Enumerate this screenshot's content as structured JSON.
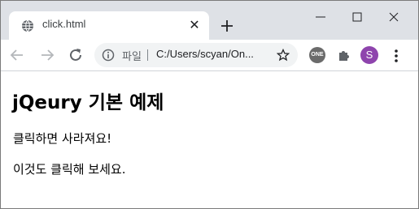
{
  "tab": {
    "title": "click.html",
    "close_glyph": "✕",
    "favicon": "globe-icon"
  },
  "new_tab": {
    "icon": "plus-icon"
  },
  "window_controls": {
    "minimize": "minimize-icon",
    "maximize": "maximize-icon",
    "close": "close-icon"
  },
  "toolbar": {
    "back": "back-arrow-icon",
    "forward": "forward-arrow-icon",
    "reload": "reload-icon",
    "omnibox": {
      "label": "파일",
      "url": "C:/Users/scyan/On..."
    },
    "bookmark": "star-icon",
    "extension_one": "ONE",
    "extensions": "puzzle-icon",
    "profile_initial": "S",
    "menu": "kebab-menu-icon"
  },
  "page": {
    "heading": "jQeury 기본 예제",
    "paragraph1": "클릭하면 사라져요!",
    "paragraph2": "이것도 클릭해 보세요."
  },
  "colors": {
    "tabstrip": "#dee1e6",
    "omnibox": "#f1f3f4",
    "profile": "#8e44ad"
  }
}
